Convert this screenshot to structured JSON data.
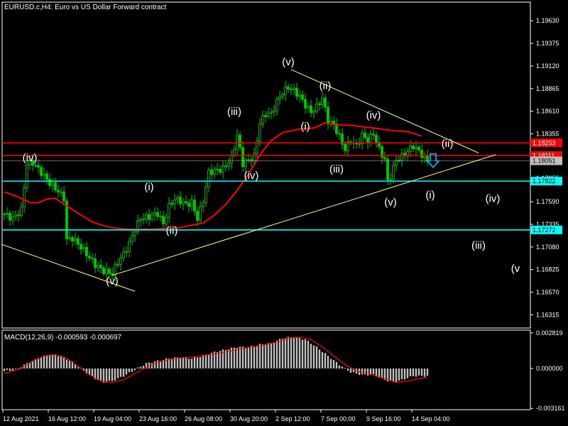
{
  "window": {
    "title": "EURUSD.c,H4:  Euro vs US Dollar Forward contract"
  },
  "colors": {
    "background": "#000000",
    "axis": "#ffffff",
    "bull": "#00c800",
    "bear": "#00c800",
    "ma": "#ff0000",
    "trendline": "#ffff7f",
    "resistance": "#ff0000",
    "support": "#00ffff",
    "bid": "#bfbfbf",
    "macd_hist": "#c0c0c0",
    "macd_signal": "#ff0000",
    "arrow": "#00bfff"
  },
  "chart_data": [
    {
      "type": "candlestick",
      "title": "EURUSD.c,H4:  Euro vs US Dollar Forward contract",
      "ylim": [
        1.16166,
        1.1984
      ],
      "y_ticks": [
        "1.19630",
        "1.19375",
        "1.19120",
        "1.18865",
        "1.18610",
        "1.18355",
        "1.18105",
        "1.17855",
        "1.17590",
        "1.17335",
        "1.17080",
        "1.16825",
        "1.16570",
        "1.16315"
      ],
      "x_ticks": [
        "12 Aug 2021",
        "16 Aug 12:00",
        "19 Aug 04:00",
        "23 Aug 16:00",
        "26 Aug 08:00",
        "30 Aug 20:00",
        "2 Sep 12:00",
        "7 Sep 00:00",
        "9 Sep 16:00",
        "14 Sep 04:00"
      ],
      "price_labels": [
        {
          "value": 1.18253,
          "text": "1.18253",
          "kind": "resistance"
        },
        {
          "value": 1.18111,
          "text": "1.18111",
          "kind": "resistance"
        },
        {
          "value": 1.18051,
          "text": "1.18051",
          "kind": "bid"
        },
        {
          "value": 1.17822,
          "text": "1.17822",
          "kind": "support"
        },
        {
          "value": 1.17272,
          "text": "1.17272",
          "kind": "support"
        }
      ],
      "ma_path": [
        [
          0,
          1.177
        ],
        [
          5,
          1.1764
        ],
        [
          9,
          1.1758
        ],
        [
          12,
          1.1758
        ],
        [
          15,
          1.1762
        ],
        [
          18,
          1.1763
        ],
        [
          21,
          1.1756
        ],
        [
          26,
          1.1746
        ],
        [
          31,
          1.1736
        ],
        [
          37,
          1.173
        ],
        [
          43,
          1.1728
        ],
        [
          52,
          1.1728
        ],
        [
          62,
          1.173
        ],
        [
          70,
          1.1735
        ],
        [
          74,
          1.1744
        ],
        [
          78,
          1.1756
        ],
        [
          82,
          1.1772
        ],
        [
          86,
          1.179
        ],
        [
          90,
          1.1812
        ],
        [
          94,
          1.1828
        ],
        [
          98,
          1.1837
        ],
        [
          104,
          1.1841
        ],
        [
          109,
          1.1842
        ],
        [
          113,
          1.1848
        ],
        [
          116,
          1.1846
        ],
        [
          122,
          1.1845
        ],
        [
          130,
          1.1842
        ],
        [
          137,
          1.1839
        ],
        [
          142,
          1.1838
        ],
        [
          147,
          1.1833
        ]
      ],
      "trendlines": [
        {
          "from": [
            -1,
            1.1711
          ],
          "to": [
            46,
            1.1658
          ]
        },
        {
          "from": [
            38,
            1.1676
          ],
          "to": [
            173,
            1.1812
          ]
        },
        {
          "from": [
            101,
            1.1908
          ],
          "to": [
            167,
            1.1814
          ]
        }
      ],
      "wave_labels": [
        {
          "text": "(iv)",
          "at": [
            9,
            1.1808
          ]
        },
        {
          "text": "(v)",
          "at": [
            38,
            1.1669
          ]
        },
        {
          "text": "(i)",
          "at": [
            51,
            1.1775
          ]
        },
        {
          "text": "(ii)",
          "at": [
            59,
            1.1726
          ]
        },
        {
          "text": "(iii)",
          "at": [
            81,
            1.186
          ]
        },
        {
          "text": "(iv)",
          "at": [
            87,
            1.1788
          ]
        },
        {
          "text": "(v)",
          "at": [
            100,
            1.1916
          ]
        },
        {
          "text": "(ii)",
          "at": [
            113,
            1.1889
          ]
        },
        {
          "text": "(i)",
          "at": [
            106,
            1.1843
          ]
        },
        {
          "text": "(iii)",
          "at": [
            117,
            1.1795
          ]
        },
        {
          "text": "(iv)",
          "at": [
            130,
            1.1856
          ]
        },
        {
          "text": "(v)",
          "at": [
            136,
            1.1758
          ]
        },
        {
          "text": "(ii)",
          "at": [
            156,
            1.1824
          ]
        },
        {
          "text": "(i)",
          "at": [
            150,
            1.1766
          ]
        },
        {
          "text": "(iv)",
          "at": [
            172,
            1.1762
          ]
        },
        {
          "text": "(iii)",
          "at": [
            167,
            1.1709
          ]
        },
        {
          "text": "(v",
          "at": [
            180,
            1.1683
          ]
        }
      ],
      "candles_anchor": [
        [
          0,
          1.1745
        ],
        [
          3,
          1.174
        ],
        [
          6,
          1.175
        ],
        [
          8,
          1.1802
        ],
        [
          10,
          1.1803
        ],
        [
          13,
          1.1792
        ],
        [
          16,
          1.178
        ],
        [
          19,
          1.1771
        ],
        [
          21,
          1.1763
        ],
        [
          22,
          1.1716
        ],
        [
          24,
          1.1718
        ],
        [
          27,
          1.1708
        ],
        [
          30,
          1.1696
        ],
        [
          32,
          1.1688
        ],
        [
          35,
          1.1681
        ],
        [
          38,
          1.1678
        ],
        [
          40,
          1.1691
        ],
        [
          42,
          1.17
        ],
        [
          44,
          1.1712
        ],
        [
          46,
          1.1728
        ],
        [
          48,
          1.174
        ],
        [
          51,
          1.1742
        ],
        [
          54,
          1.1746
        ],
        [
          56,
          1.1734
        ],
        [
          58,
          1.1754
        ],
        [
          60,
          1.1762
        ],
        [
          62,
          1.176
        ],
        [
          64,
          1.1756
        ],
        [
          66,
          1.1758
        ],
        [
          68,
          1.174
        ],
        [
          70,
          1.176
        ],
        [
          72,
          1.1792
        ],
        [
          74,
          1.1794
        ],
        [
          77,
          1.1796
        ],
        [
          80,
          1.1808
        ],
        [
          82,
          1.1834
        ],
        [
          84,
          1.1802
        ],
        [
          86,
          1.1806
        ],
        [
          88,
          1.181
        ],
        [
          90,
          1.1848
        ],
        [
          92,
          1.1858
        ],
        [
          94,
          1.1858
        ],
        [
          96,
          1.1872
        ],
        [
          98,
          1.1882
        ],
        [
          100,
          1.1888
        ],
        [
          102,
          1.1884
        ],
        [
          104,
          1.1878
        ],
        [
          106,
          1.1868
        ],
        [
          108,
          1.186
        ],
        [
          110,
          1.1866
        ],
        [
          112,
          1.1876
        ],
        [
          114,
          1.185
        ],
        [
          116,
          1.1846
        ],
        [
          118,
          1.1832
        ],
        [
          120,
          1.1818
        ],
        [
          122,
          1.1828
        ],
        [
          124,
          1.1822
        ],
        [
          126,
          1.1834
        ],
        [
          128,
          1.1828
        ],
        [
          130,
          1.1836
        ],
        [
          132,
          1.1818
        ],
        [
          134,
          1.1806
        ],
        [
          135,
          1.1782
        ],
        [
          136,
          1.1788
        ],
        [
          138,
          1.1806
        ],
        [
          140,
          1.181
        ],
        [
          142,
          1.1816
        ],
        [
          144,
          1.1822
        ],
        [
          146,
          1.1816
        ],
        [
          148,
          1.1808
        ],
        [
          149,
          1.1805
        ]
      ],
      "signal_arrow": {
        "at": [
          151,
          1.1805
        ],
        "direction": "down"
      }
    },
    {
      "type": "bar",
      "title": "MACD(12,26,9) -0.000593 -0.000697",
      "ylim": [
        -0.00326,
        0.00304
      ],
      "y_ticks": [
        "0.002819",
        "0.000000",
        "-0.003161"
      ],
      "hist_anchor": [
        [
          0,
          -0.0002
        ],
        [
          4,
          -0.0001
        ],
        [
          8,
          0.0004
        ],
        [
          12,
          0.0008
        ],
        [
          16,
          0.0011
        ],
        [
          20,
          0.001
        ],
        [
          24,
          0.0005
        ],
        [
          28,
          -0.0002
        ],
        [
          32,
          -0.0008
        ],
        [
          35,
          -0.0011
        ],
        [
          38,
          -0.001
        ],
        [
          42,
          -0.0006
        ],
        [
          46,
          -0.0001
        ],
        [
          50,
          0.0004
        ],
        [
          54,
          0.0006
        ],
        [
          58,
          0.0008
        ],
        [
          62,
          0.0009
        ],
        [
          66,
          0.0008
        ],
        [
          70,
          0.001
        ],
        [
          74,
          0.0013
        ],
        [
          78,
          0.0015
        ],
        [
          82,
          0.0017
        ],
        [
          86,
          0.0017
        ],
        [
          90,
          0.0019
        ],
        [
          94,
          0.002
        ],
        [
          98,
          0.0024
        ],
        [
          102,
          0.0025
        ],
        [
          106,
          0.0023
        ],
        [
          110,
          0.0017
        ],
        [
          114,
          0.001
        ],
        [
          118,
          0.0003
        ],
        [
          122,
          -0.0003
        ],
        [
          126,
          -0.0005
        ],
        [
          130,
          -0.0005
        ],
        [
          134,
          -0.0009
        ],
        [
          137,
          -0.0011
        ],
        [
          140,
          -0.0009
        ],
        [
          144,
          -0.0006
        ],
        [
          147,
          -0.0006
        ],
        [
          149,
          -0.0006
        ]
      ],
      "signal_anchor": [
        [
          0,
          -0.0004
        ],
        [
          6,
          0.0
        ],
        [
          10,
          0.0006
        ],
        [
          14,
          0.001
        ],
        [
          18,
          0.0011
        ],
        [
          22,
          0.0008
        ],
        [
          26,
          0.0002
        ],
        [
          30,
          -0.0005
        ],
        [
          34,
          -0.001
        ],
        [
          38,
          -0.0011
        ],
        [
          42,
          -0.0009
        ],
        [
          46,
          -0.0004
        ],
        [
          50,
          0.0001
        ],
        [
          54,
          0.0005
        ],
        [
          60,
          0.0008
        ],
        [
          66,
          0.0009
        ],
        [
          72,
          0.0011
        ],
        [
          78,
          0.0013
        ],
        [
          84,
          0.0016
        ],
        [
          90,
          0.0018
        ],
        [
          96,
          0.0021
        ],
        [
          100,
          0.0024
        ],
        [
          104,
          0.0025
        ],
        [
          108,
          0.0023
        ],
        [
          112,
          0.0017
        ],
        [
          116,
          0.001
        ],
        [
          120,
          0.0003
        ],
        [
          124,
          -0.0002
        ],
        [
          128,
          -0.0004
        ],
        [
          134,
          -0.0008
        ],
        [
          138,
          -0.0011
        ],
        [
          142,
          -0.001
        ],
        [
          146,
          -0.0008
        ],
        [
          149,
          -0.0007
        ]
      ]
    }
  ]
}
